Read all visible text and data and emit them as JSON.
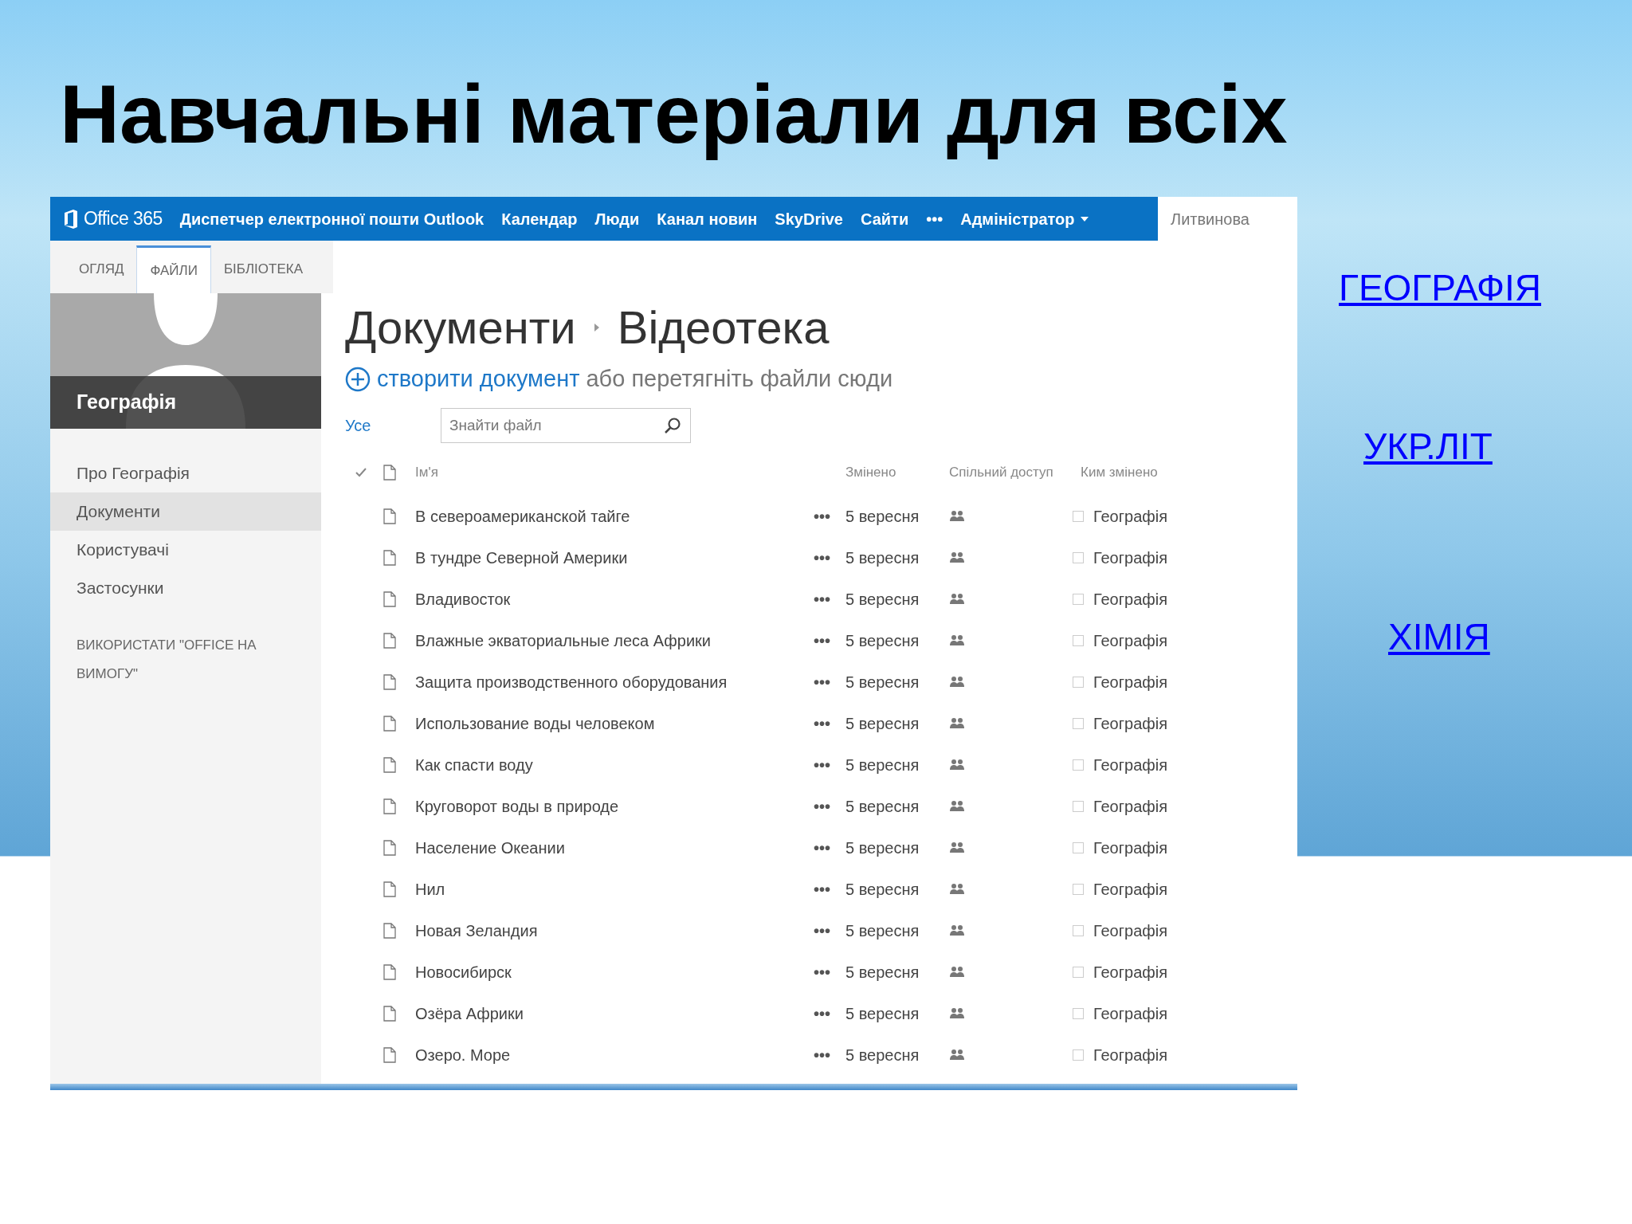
{
  "slide_title": "Навчальні матеріали для всіх",
  "top_bar": {
    "brand": "Office 365",
    "nav": [
      "Диспетчер електронної пошти Outlook",
      "Календар",
      "Люди",
      "Канал новин",
      "SkyDrive",
      "Сайти",
      "•••",
      "Адміністратор"
    ],
    "user": "Литвинова"
  },
  "tabs": [
    {
      "label": "ОГЛЯД",
      "selected": false
    },
    {
      "label": "ФАЙЛИ",
      "selected": true
    },
    {
      "label": "БІБЛІОТЕКА",
      "selected": false
    }
  ],
  "sidebar": {
    "site_name": "Географія",
    "items": [
      {
        "label": "Про Географія",
        "selected": false
      },
      {
        "label": "Документи",
        "selected": true
      },
      {
        "label": "Користувачі",
        "selected": false
      },
      {
        "label": "Застосунки",
        "selected": false
      }
    ],
    "footer_link": "ВИКОРИСТАТИ \"OFFICE НА ВИМОГУ\""
  },
  "breadcrumb": [
    "Документи",
    "Відеотека"
  ],
  "create": {
    "link": "створити документ",
    "rest": "або перетягніть файли сюди"
  },
  "view": "Усе",
  "search": {
    "placeholder": "Знайти файл"
  },
  "table": {
    "columns": [
      "Ім'я",
      "Змінено",
      "Спільний доступ",
      "Ким змінено"
    ],
    "rows": [
      {
        "name": "В североамериканской тайге",
        "modified": "5 вересня",
        "by": "Географія",
        "checked": false
      },
      {
        "name": "В тундре Северной Америки",
        "modified": "5 вересня",
        "by": "Географія",
        "checked": false
      },
      {
        "name": "Владивосток",
        "modified": "5 вересня",
        "by": "Географія",
        "checked": false
      },
      {
        "name": "Влажные экваториальные леса Африки",
        "modified": "5 вересня",
        "by": "Географія",
        "checked": false
      },
      {
        "name": "Защита производственного оборудования",
        "modified": "5 вересня",
        "by": "Географія",
        "checked": false
      },
      {
        "name": "Использование воды человеком",
        "modified": "5 вересня",
        "by": "Географія",
        "checked": false
      },
      {
        "name": "Как спасти воду",
        "modified": "5 вересня",
        "by": "Географія",
        "checked": false
      },
      {
        "name": "Круговорот воды в природе",
        "modified": "5 вересня",
        "by": "Географія",
        "checked": false
      },
      {
        "name": "Население Океании",
        "modified": "5 вересня",
        "by": "Географія",
        "checked": false
      },
      {
        "name": "Нил",
        "modified": "5 вересня",
        "by": "Географія",
        "checked": false
      },
      {
        "name": "Новая Зеландия",
        "modified": "5 вересня",
        "by": "Географія",
        "checked": false
      },
      {
        "name": "Новосибирск",
        "modified": "5 вересня",
        "by": "Географія",
        "checked": false
      },
      {
        "name": "Озёра Африки",
        "modified": "5 вересня",
        "by": "Географія",
        "checked": false
      },
      {
        "name": "Озеро. Море",
        "modified": "5 вересня",
        "by": "Географія",
        "checked": false
      }
    ]
  },
  "links": [
    "ГЕОГРАФІЯ",
    "УКР.ЛІТ",
    "ХІМІЯ"
  ]
}
